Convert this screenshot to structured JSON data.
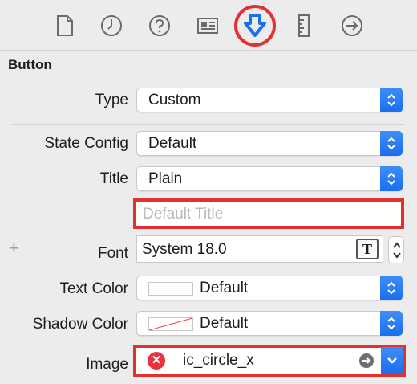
{
  "toolbar": {
    "icons": [
      "file-inspector-icon",
      "history-icon",
      "help-icon",
      "identity-icon",
      "attributes-inspector-icon",
      "size-inspector-icon",
      "connections-icon"
    ],
    "selected": "attributes-inspector-icon",
    "accent": "#1a6ff0",
    "highlight": "#e53030"
  },
  "section": {
    "title": "Button"
  },
  "type": {
    "label": "Type",
    "value": "Custom"
  },
  "state_config": {
    "label": "State Config",
    "value": "Default"
  },
  "title": {
    "label": "Title",
    "value": "Plain",
    "placeholder": "Default Title"
  },
  "font": {
    "label": "Font",
    "value": "System 18.0",
    "add": "+",
    "picker_glyph": "T"
  },
  "text_color": {
    "label": "Text Color",
    "value": "Default"
  },
  "shadow_color": {
    "label": "Shadow Color",
    "value": "Default"
  },
  "image": {
    "label": "Image",
    "value": "ic_circle_x",
    "error_glyph": "✕"
  }
}
